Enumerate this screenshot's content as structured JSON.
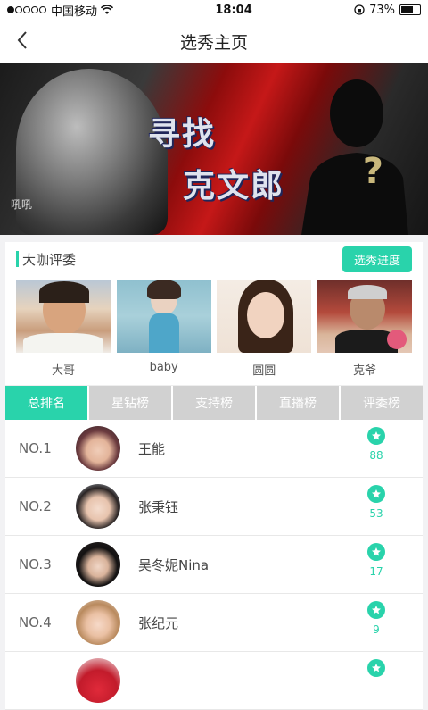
{
  "status_bar": {
    "carrier": "中国移动",
    "time": "18:04",
    "battery": "73%",
    "battery_level": 0.73
  },
  "navbar": {
    "title": "选秀主页",
    "back_icon": "chevron-left-icon"
  },
  "banner": {
    "line1": "寻找",
    "line2": "克文郎",
    "question_mark": "?",
    "watermark": "吼吼"
  },
  "judges": {
    "title": "大咖评委",
    "progress_button": "选秀进度",
    "items": [
      {
        "name": "大哥"
      },
      {
        "name": "baby"
      },
      {
        "name": "圆圆"
      },
      {
        "name": "克爷"
      }
    ]
  },
  "tabs": [
    {
      "label": "总排名",
      "active": true
    },
    {
      "label": "星钻榜",
      "active": false
    },
    {
      "label": "支持榜",
      "active": false
    },
    {
      "label": "直播榜",
      "active": false
    },
    {
      "label": "评委榜",
      "active": false
    }
  ],
  "ranking": [
    {
      "rank": "NO.1",
      "name": "王能",
      "votes": "88"
    },
    {
      "rank": "NO.2",
      "name": "张秉钰",
      "votes": "53"
    },
    {
      "rank": "NO.3",
      "name": "吴冬妮Nina",
      "votes": "17"
    },
    {
      "rank": "NO.4",
      "name": "张纪元",
      "votes": "9"
    },
    {
      "rank": "",
      "name": "",
      "votes": ""
    }
  ],
  "colors": {
    "accent": "#29d3ab",
    "tab_inactive": "#d1d1d1"
  }
}
